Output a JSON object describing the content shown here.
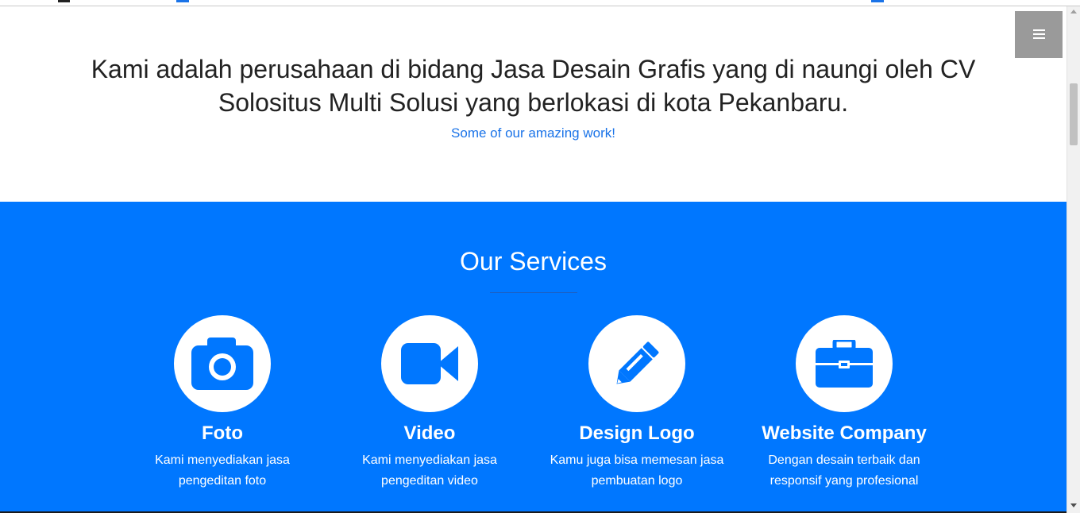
{
  "about": {
    "text": "Kami adalah perusahaan di bidang Jasa Desain Grafis yang di naungi oleh CV Solositus Multi Solusi yang berlokasi di kota Pekanbaru.",
    "subtitle": "Some of our amazing work!"
  },
  "services": {
    "title": "Our Services",
    "items": [
      {
        "name": "Foto",
        "description": "Kami menyediakan jasa pengeditan foto",
        "icon": "camera-icon"
      },
      {
        "name": "Video",
        "description": "Kami menyediakan jasa pengeditan video",
        "icon": "video-camera-icon"
      },
      {
        "name": "Design Logo",
        "description": "Kamu juga bisa memesan jasa pembuatan logo",
        "icon": "pencil-icon"
      },
      {
        "name": "Website Company",
        "description": "Dengan desain terbaik dan responsif yang profesional",
        "icon": "briefcase-icon"
      }
    ]
  },
  "menu": {
    "icon": "hamburger-menu-icon"
  },
  "colors": {
    "accent": "#0077ff",
    "link": "#1a73e8",
    "menu_button": "#9a9a9a",
    "white": "#ffffff"
  }
}
